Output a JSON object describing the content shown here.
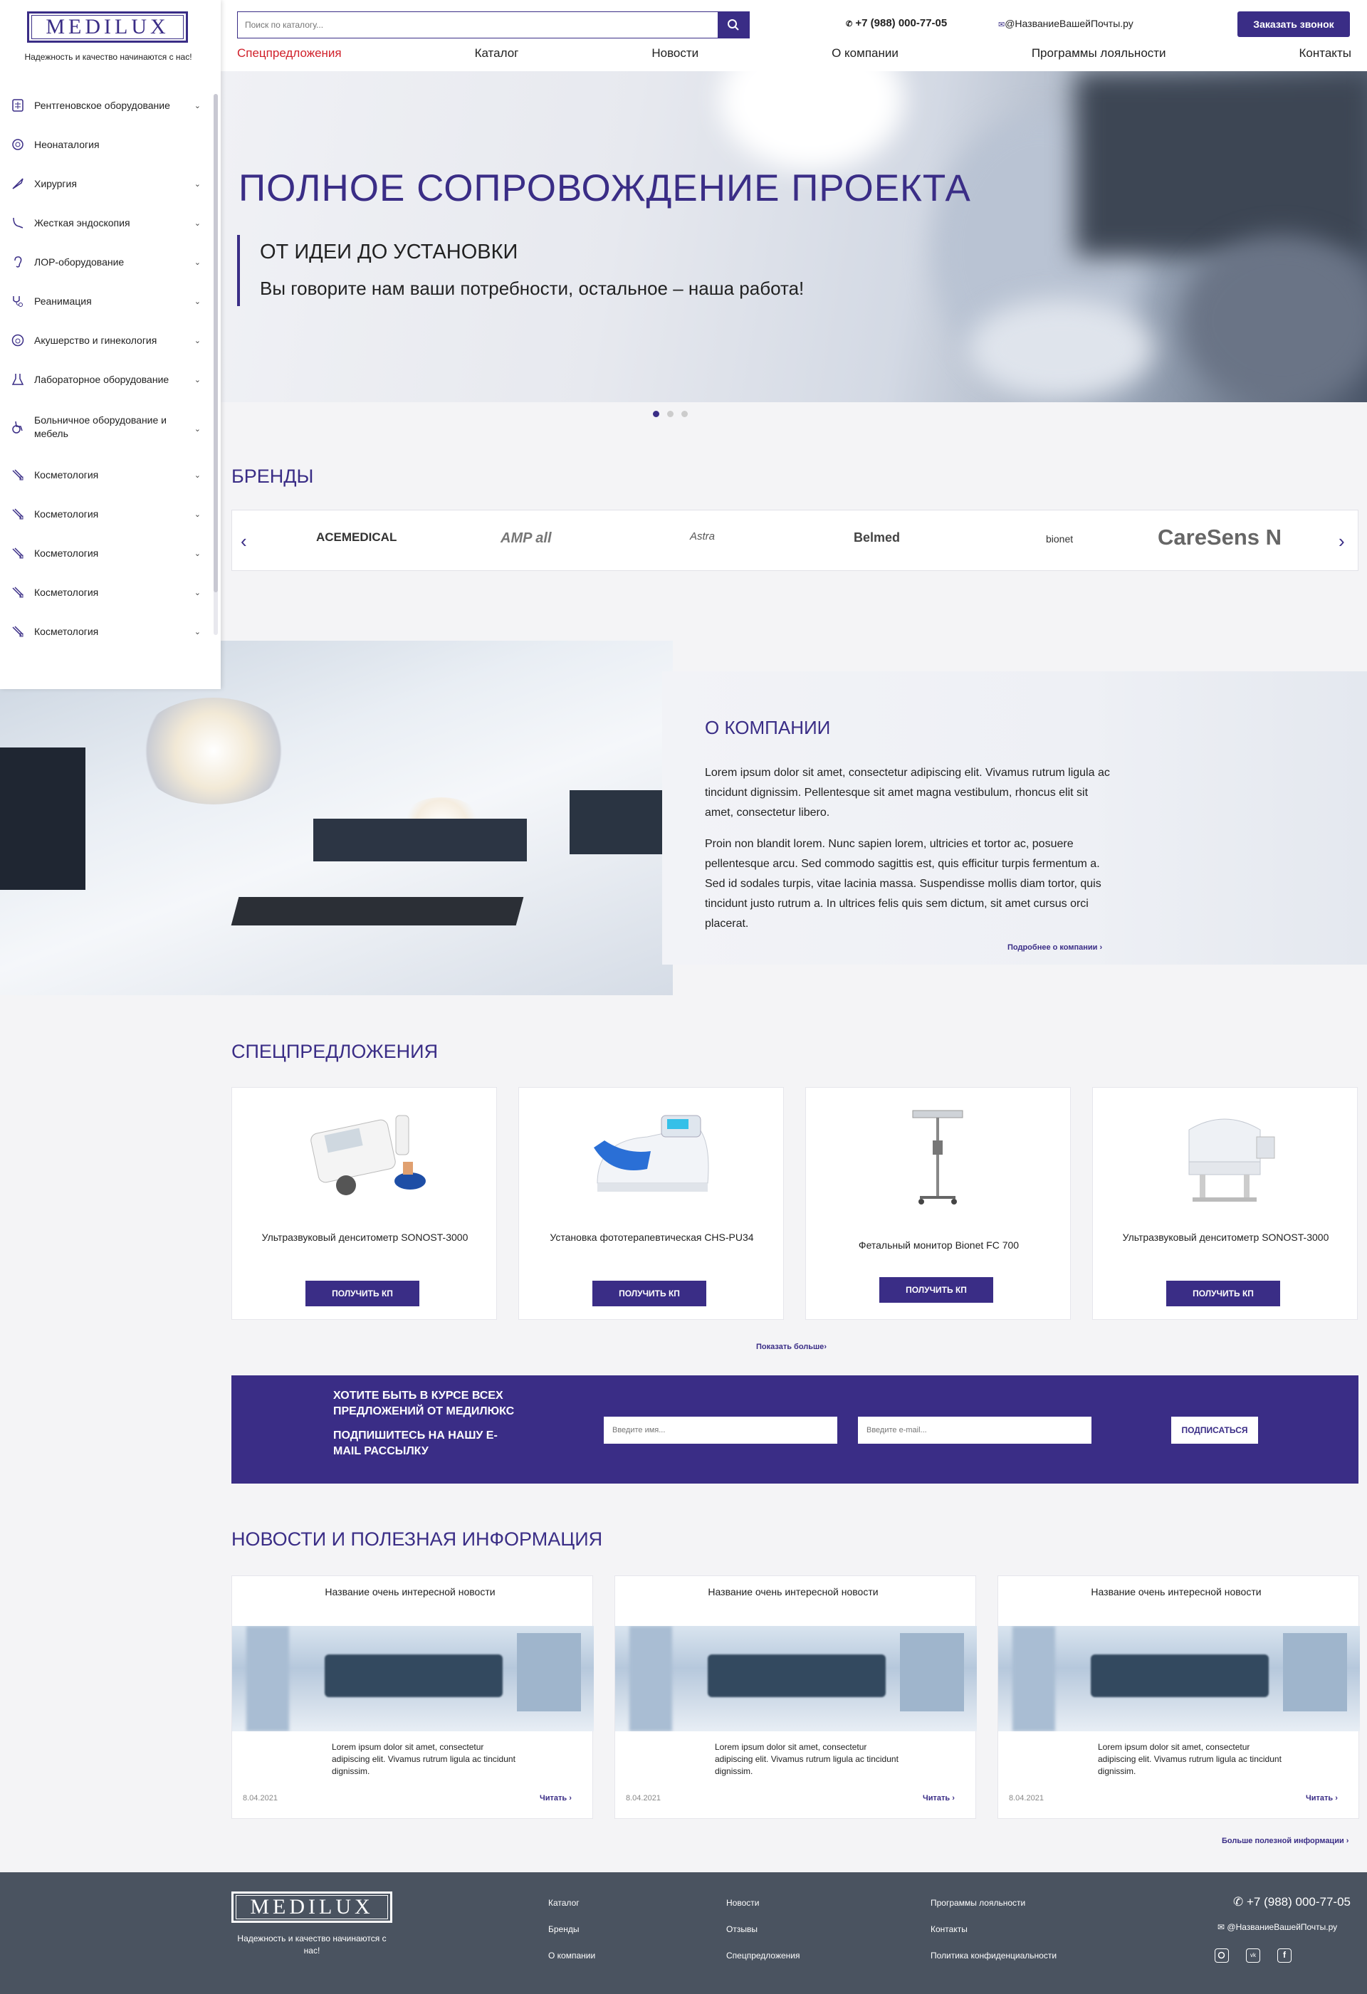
{
  "brand": {
    "logo_text": "MEDILUX",
    "tagline": "Надежность и качество начинаются с нас!"
  },
  "sidebar": {
    "items": [
      {
        "label": "Рентгеновское оборудование",
        "has_submenu": true,
        "icon": "xray-icon"
      },
      {
        "label": "Неонаталогия",
        "has_submenu": false,
        "icon": "baby-icon"
      },
      {
        "label": "Хирургия",
        "has_submenu": true,
        "icon": "scalpel-icon"
      },
      {
        "label": "Жесткая эндоскопия",
        "has_submenu": true,
        "icon": "endoscope-icon"
      },
      {
        "label": "ЛОР-оборудование",
        "has_submenu": true,
        "icon": "ear-icon"
      },
      {
        "label": "Реанимация",
        "has_submenu": true,
        "icon": "stethoscope-icon"
      },
      {
        "label": "Акушерство и гинекология",
        "has_submenu": true,
        "icon": "gynecology-icon"
      },
      {
        "label": "Лабораторное оборудование",
        "has_submenu": true,
        "icon": "lab-icon"
      },
      {
        "label": "Больничное оборудование и мебель",
        "has_submenu": true,
        "icon": "wheelchair-icon"
      },
      {
        "label": "Косметология",
        "has_submenu": true,
        "icon": "cosmetology-icon"
      },
      {
        "label": "Косметология",
        "has_submenu": true,
        "icon": "cosmetology-icon"
      },
      {
        "label": "Косметология",
        "has_submenu": true,
        "icon": "cosmetology-icon"
      },
      {
        "label": "Косметология",
        "has_submenu": true,
        "icon": "cosmetology-icon"
      },
      {
        "label": "Косметология",
        "has_submenu": true,
        "icon": "cosmetology-icon"
      }
    ]
  },
  "header": {
    "search_placeholder": "Поиск по каталогу...",
    "phone": "+7 (988) 000-77-05",
    "email": "@НазваниеВашейПочты.ру",
    "call_button": "Заказать звонок",
    "nav": [
      "Спецпредложения",
      "Каталог",
      "Новости",
      "О компании",
      "Программы лояльности",
      "Контакты"
    ]
  },
  "hero": {
    "title": "ПОЛНОЕ СОПРОВОЖДЕНИЕ ПРОЕКТА",
    "subtitle": "ОТ ИДЕИ ДО УСТАНОВКИ",
    "text": "Вы говорите нам ваши потребности, остальное – наша работа!",
    "slides_count": 3,
    "active_slide": 1
  },
  "brands": {
    "title": "БРЕНДЫ",
    "items": [
      "ACEMEDICAL",
      "AMP all",
      "Astra",
      "Belmed",
      "bionet",
      "CareSens N"
    ]
  },
  "about": {
    "title": "О КОМПАНИИ",
    "p1": "Lorem ipsum dolor sit amet, consectetur adipiscing elit. Vivamus rutrum ligula ac tincidunt dignissim. Pellentesque sit amet magna vestibulum, rhoncus elit sit amet, consectetur libero.",
    "p2": "Proin non blandit lorem. Nunc sapien lorem, ultricies et tortor ac, posuere pellentesque arcu. Sed commodo sagittis est, quis efficitur turpis fermentum a. Sed id sodales turpis, vitae lacinia massa. Suspendisse mollis diam tortor, quis tincidunt justo rutrum a. In ultrices felis quis sem dictum, sit amet cursus orci placerat.",
    "more": "Подробнее о компании"
  },
  "offers": {
    "title": "СПЕЦПРЕДЛОЖЕНИЯ",
    "items": [
      {
        "name": "Ультразвуковый денситометр SONOST-3000",
        "button": "ПОЛУЧИТЬ КП"
      },
      {
        "name": "Установка фототерапевтическая CHS-PU34",
        "button": "ПОЛУЧИТЬ КП"
      },
      {
        "name": "Фетальный монитор Bionet FC 700",
        "button": "ПОЛУЧИТЬ КП"
      },
      {
        "name": "Ультразвуковый денситометр SONOST-3000",
        "button": "ПОЛУЧИТЬ КП"
      }
    ],
    "show_more": "Показать больше"
  },
  "subscribe": {
    "line1": "ХОТИТЕ БЫТЬ В КУРСЕ ВСЕХ ПРЕДЛОЖЕНИЙ ОТ МЕДИЛЮКС",
    "line2": "ПОДПИШИТЕСЬ НА НАШУ E-MAIL РАССЫЛКУ",
    "name_placeholder": "Введите имя...",
    "email_placeholder": "Введите e-mail...",
    "button": "ПОДПИСАТЬСЯ"
  },
  "news": {
    "title": "НОВОСТИ И ПОЛЕЗНАЯ ИНФОРМАЦИЯ",
    "items": [
      {
        "title": "Название очень интересной новости",
        "text": "Lorem ipsum dolor sit amet, consectetur adipiscing elit. Vivamus rutrum ligula ac tincidunt dignissim.",
        "date": "8.04.2021",
        "read": "Читать"
      },
      {
        "title": "Название очень интересной новости",
        "text": "Lorem ipsum dolor sit amet, consectetur adipiscing elit. Vivamus rutrum ligula ac tincidunt dignissim.",
        "date": "8.04.2021",
        "read": "Читать"
      },
      {
        "title": "Название очень интересной новости",
        "text": "Lorem ipsum dolor sit amet, consectetur adipiscing elit. Vivamus rutrum ligula ac tincidunt dignissim.",
        "date": "8.04.2021",
        "read": "Читать"
      }
    ],
    "more": "Больше полезной информации"
  },
  "footer": {
    "logo_text": "MEDILUX",
    "tagline": "Надежность и качество начинаются с нас!",
    "col1": [
      "Каталог",
      "Бренды",
      "О компании"
    ],
    "col2": [
      "Новости",
      "Отзывы",
      "Спецпредложения"
    ],
    "col3": [
      "Программы лояльности",
      "Контакты",
      "Политика конфиденциальности"
    ],
    "phone": "+7 (988) 000-77-05",
    "email": "@НазваниеВашейПочты.ру",
    "social": [
      "instagram-icon",
      "vk-icon",
      "facebook-icon"
    ]
  },
  "colors": {
    "accent": "#3a2d86",
    "nav_active": "#d0202a",
    "footer_bg": "#4a5360"
  }
}
